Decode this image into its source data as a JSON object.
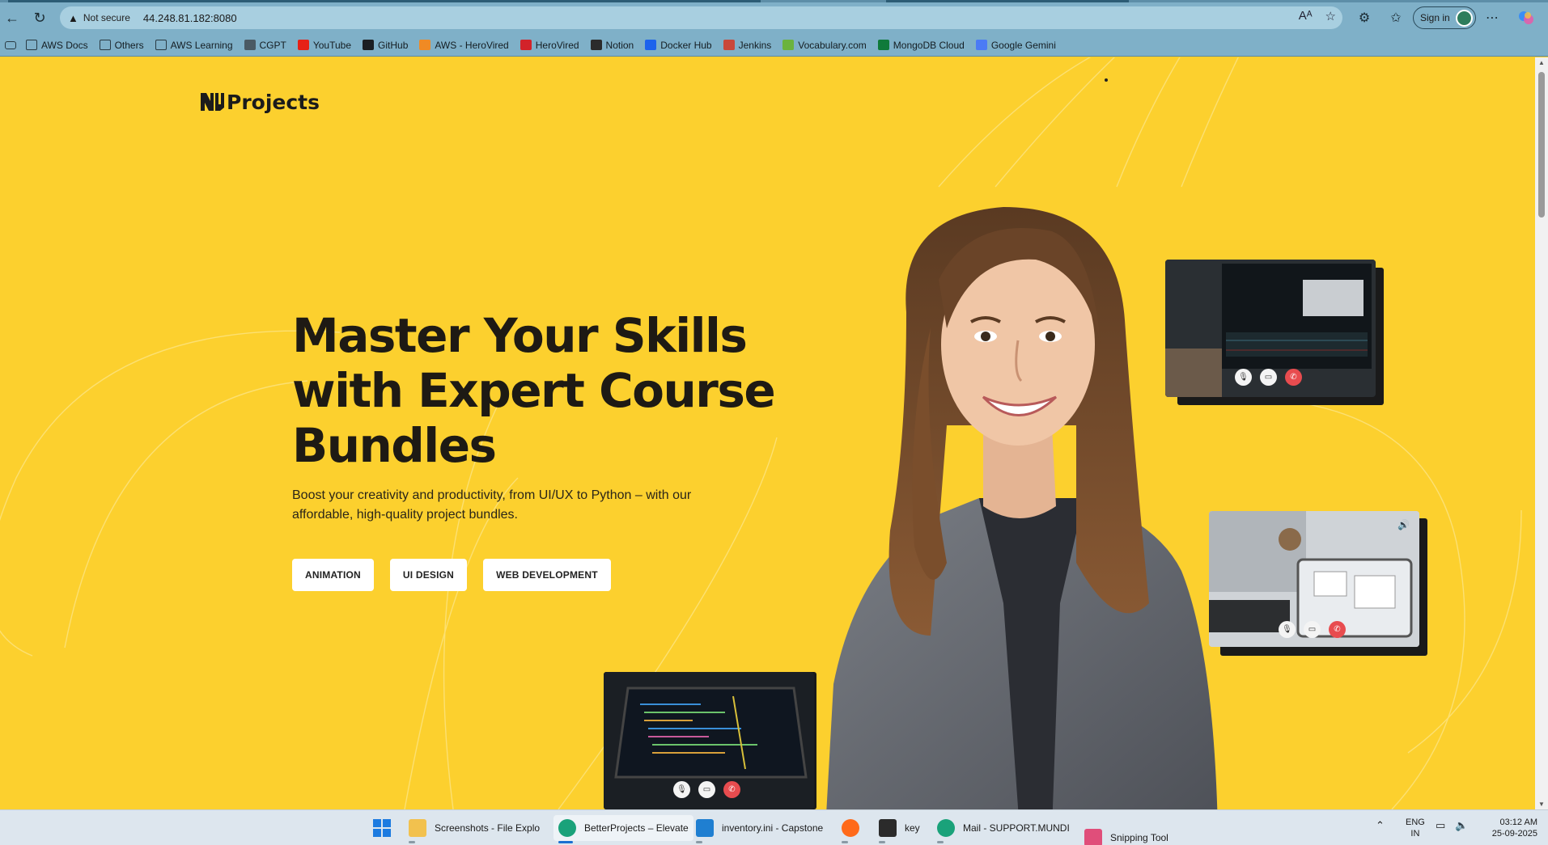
{
  "browser": {
    "address": {
      "security_label": "Not secure",
      "url": "44.248.81.182:8080"
    },
    "signin_label": "Sign in",
    "bookmarks": [
      {
        "label": "AWS Docs",
        "icon": "folder-icon",
        "color": ""
      },
      {
        "label": "Others",
        "icon": "folder-icon",
        "color": ""
      },
      {
        "label": "AWS Learning",
        "icon": "folder-icon",
        "color": ""
      },
      {
        "label": "CGPT",
        "icon": "chatgpt-icon",
        "color": "#4a5a64"
      },
      {
        "label": "YouTube",
        "icon": "youtube-icon",
        "color": "#e62117"
      },
      {
        "label": "GitHub",
        "icon": "github-icon",
        "color": "#1b1f23"
      },
      {
        "label": "AWS - HeroVired",
        "icon": "herovired-icon",
        "color": "#f08a24"
      },
      {
        "label": "HeroVired",
        "icon": "herovired-v-icon",
        "color": "#d2232a"
      },
      {
        "label": "Notion",
        "icon": "notion-icon",
        "color": "#2b2b2b"
      },
      {
        "label": "Docker Hub",
        "icon": "docker-icon",
        "color": "#1d63ed"
      },
      {
        "label": "Jenkins",
        "icon": "jenkins-icon",
        "color": "#c9483a"
      },
      {
        "label": "Vocabulary.com",
        "icon": "vocabulary-icon",
        "color": "#6bb33e"
      },
      {
        "label": "MongoDB Cloud",
        "icon": "mongodb-icon",
        "color": "#0f7a3a"
      },
      {
        "label": "Google Gemini",
        "icon": "gemini-icon",
        "color": "#4b7bf5"
      }
    ]
  },
  "site": {
    "logo_text": "Projects",
    "hero": {
      "title_lines": [
        "Master Your Skills",
        "with Expert Course",
        "Bundles"
      ],
      "subtitle": "Boost your creativity and productivity, from UI/UX to Python – with our affordable, high-quality project bundles.",
      "chips": [
        "ANIMATION",
        "UI DESIGN",
        "WEB DEVELOPMENT"
      ]
    },
    "colors": {
      "background": "#fcd02e",
      "title": "#1e1a14",
      "end_call": "#e84c4f"
    }
  },
  "taskbar": {
    "items": [
      {
        "label": "Screenshots - File Explo",
        "icon": "file-explorer-icon",
        "color": "#f2c14e"
      },
      {
        "label": "BetterProjects – Elevate",
        "icon": "edge-icon",
        "color": "#1aa27a"
      },
      {
        "label": "inventory.ini - Capstone",
        "icon": "vscode-icon",
        "color": "#1f7fd1"
      },
      {
        "label": "",
        "icon": "firefox-icon",
        "color": "#ff6a1a"
      },
      {
        "label": "key",
        "icon": "terminal-icon",
        "color": "#2b2b2b"
      },
      {
        "label": "Mail - SUPPORT.MUNDI",
        "icon": "edge-icon",
        "color": "#1aa27a"
      },
      {
        "label": "Snipping Tool",
        "icon": "snipping-tool-icon",
        "color": "#e04e7a"
      }
    ],
    "language": [
      "ENG",
      "IN"
    ],
    "time": "03:12 AM",
    "date": "25-09-2025"
  }
}
